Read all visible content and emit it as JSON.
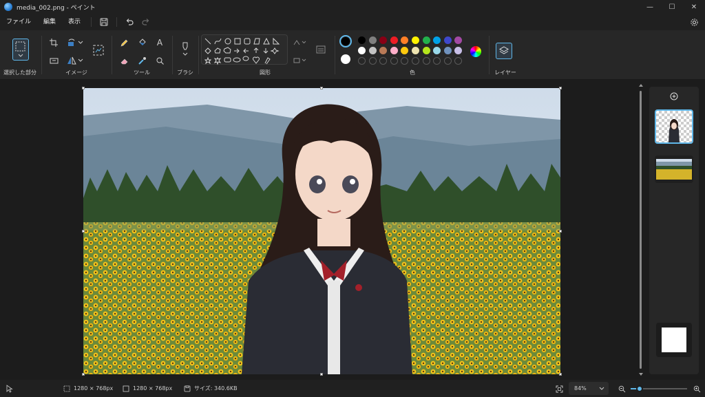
{
  "window": {
    "title": "media_002.png - ペイント",
    "minimize": "—",
    "maximize": "☐",
    "close": "✕"
  },
  "menu": {
    "file": "ファイル",
    "edit": "編集",
    "view": "表示"
  },
  "ribbon": {
    "selection_label": "選択した部分",
    "image_label": "イメージ",
    "tools_label": "ツール",
    "brushes_label": "ブラシ",
    "shapes_label": "図形",
    "colors_label": "色",
    "layers_label": "レイヤー",
    "text_tool": "A"
  },
  "colors": {
    "primary": "#000000",
    "secondary": "#ffffff",
    "palette_row1": [
      "#000000",
      "#7f7f7f",
      "#880015",
      "#ed1c24",
      "#ff7f27",
      "#fff200",
      "#22b14c",
      "#00a2e8",
      "#3f48cc",
      "#a349a4"
    ],
    "palette_row2": [
      "#ffffff",
      "#c3c3c3",
      "#b97a57",
      "#ffaec9",
      "#ffc90e",
      "#efe4b0",
      "#b5e61d",
      "#99d9ea",
      "#7092be",
      "#c8bfe7"
    ],
    "accent": "#60b8ea"
  },
  "status": {
    "selection_size": "1280 × 768px",
    "canvas_size": "1280 × 768px",
    "file_size": "サイズ: 340.6KB",
    "zoom": "84%",
    "zoom_fraction": 0.16
  }
}
